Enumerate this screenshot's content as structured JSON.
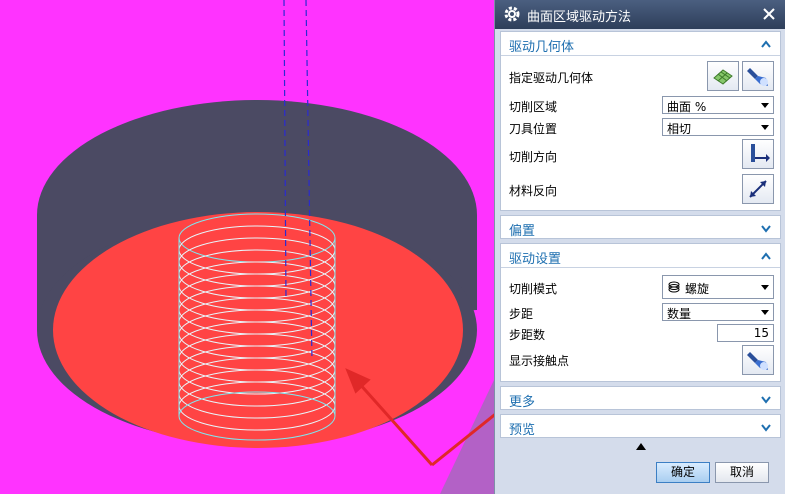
{
  "dialog": {
    "title": "曲面区域驱动方法",
    "groups": {
      "drive_geometry": {
        "title": "驱动几何体",
        "specify_label": "指定驱动几何体",
        "cut_area_label": "切削区域",
        "cut_area_value": "曲面 %",
        "tool_position_label": "刀具位置",
        "tool_position_value": "相切",
        "cut_direction_label": "切削方向",
        "material_reverse_label": "材料反向"
      },
      "offset": {
        "title": "偏置"
      },
      "drive_settings": {
        "title": "驱动设置",
        "cut_pattern_label": "切削模式",
        "cut_pattern_value": "螺旋",
        "stepover_label": "步距",
        "stepover_value": "数量",
        "stepover_count_label": "步距数",
        "stepover_count_value": "15",
        "show_contact_label": "显示接触点"
      },
      "more": {
        "title": "更多"
      },
      "preview": {
        "title": "预览"
      }
    },
    "ok_label": "确定",
    "cancel_label": "取消"
  },
  "icons": [
    "gear-icon",
    "close-icon",
    "chevron-up-icon",
    "chevron-down-icon",
    "surface-select-icon",
    "flashlight-icon",
    "cut-direction-icon",
    "material-reverse-icon",
    "spiral-pattern-icon"
  ],
  "colors": {
    "background": "#ff33ff",
    "pocket_floor": "#ff4444",
    "pocket_wall": "#4b4a63",
    "toolpath": "#7fe8f0",
    "annotation_arrow": "#e02828",
    "header_text": "#1e6fb0"
  }
}
